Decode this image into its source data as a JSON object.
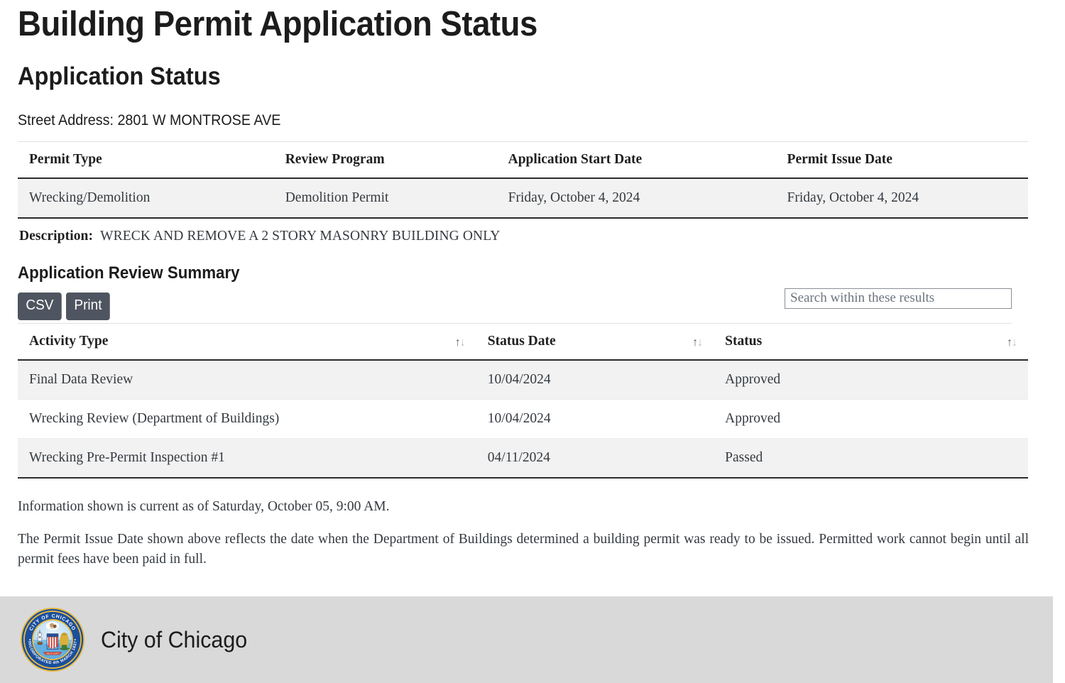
{
  "page": {
    "title": "Building Permit Application Status",
    "section_title": "Application Status",
    "street_address": "Street Address: 2801 W MONTROSE AVE"
  },
  "permit_table": {
    "headers": [
      "Permit Type",
      "Review Program",
      "Application Start Date",
      "Permit Issue Date"
    ],
    "rows": [
      {
        "permit_type": "Wrecking/Demolition",
        "review_program": "Demolition Permit",
        "application_start_date": "Friday, October 4, 2024",
        "permit_issue_date": "Friday, October 4, 2024"
      }
    ]
  },
  "description": {
    "label": "Description:",
    "value": "WRECK AND REMOVE A 2 STORY MASONRY BUILDING ONLY"
  },
  "review_summary": {
    "heading": "Application Review Summary",
    "buttons": {
      "csv": "CSV",
      "print": "Print"
    },
    "search": {
      "placeholder": "Search within these results",
      "value": ""
    },
    "headers": [
      "Activity Type",
      "Status Date",
      "Status"
    ],
    "sort_icon_up": "↑",
    "sort_icon_down": "↓",
    "rows": [
      {
        "activity_type": "Final Data Review",
        "status_date": "10/04/2024",
        "status": "Approved"
      },
      {
        "activity_type": "Wrecking Review (Department of Buildings)",
        "status_date": "10/04/2024",
        "status": "Approved"
      },
      {
        "activity_type": "Wrecking Pre-Permit Inspection #1",
        "status_date": "04/11/2024",
        "status": "Passed"
      }
    ]
  },
  "notes": {
    "current_as_of": "Information shown is current as of Saturday, October 05, 9:00 AM.",
    "disclaimer": "The Permit Issue Date shown above reflects the date when the Department of Buildings determined a building permit was ready to be issued. Permitted work cannot begin until all permit fees have been paid in full."
  },
  "footer": {
    "label": "City of Chicago",
    "seal": {
      "top_text": "CITY OF CHICAGO",
      "bottom_text": "INCORPORATED 4th MARCH 1837"
    }
  },
  "colors": {
    "button_bg": "#4f5560",
    "row_stripe": "#f2f2f2",
    "footer_bg": "#d9d9d9",
    "table_border": "#2b2b2b",
    "seal_ring": "#1b4f9c",
    "seal_gold": "#e4b63a"
  }
}
